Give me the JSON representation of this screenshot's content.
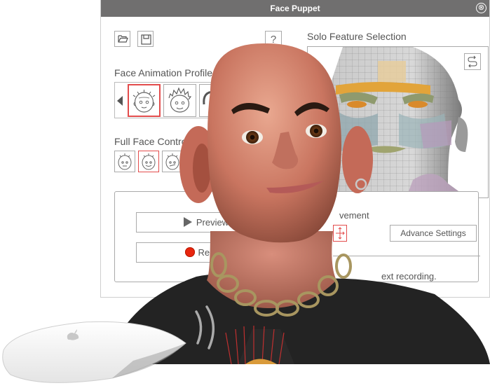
{
  "window": {
    "title": "Face Puppet",
    "close_icon": "⊗"
  },
  "toolbar": {
    "open_icon": "folder-open-icon",
    "save_icon": "save-disk-icon",
    "help_label": "?"
  },
  "profile": {
    "label": "Face Animation Profile:",
    "selected_index": 0,
    "tiles": [
      "bald-face-profile",
      "spiky-hair-face-profile",
      "hair-face-profile"
    ]
  },
  "full_face_control": {
    "label": "Full Face Control:",
    "selected_index": 1,
    "tiles": [
      "neutral-face",
      "smile-face",
      "grimace-face"
    ]
  },
  "solo_feature": {
    "label": "Solo Feature Selection",
    "swap_icon": "swap-arrows-icon"
  },
  "controls": {
    "preview_label": "Preview",
    "record_label": "Record",
    "movement_label": "vement",
    "advance_settings_label": "Advance Settings",
    "hint_text": "ext recording."
  },
  "colors": {
    "titlebar": "#706f6f",
    "selected_border": "#e34c4c",
    "record_red": "#e8250e"
  }
}
